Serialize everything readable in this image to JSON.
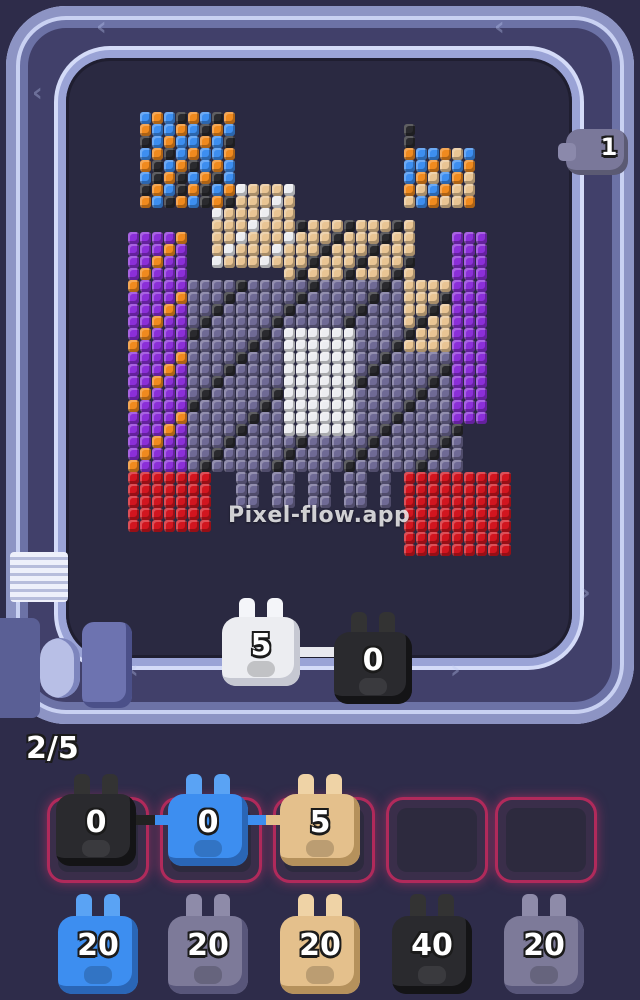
{
  "watermark": {
    "text": "Pixel-flow.app"
  },
  "track_counter": {
    "value": "1"
  },
  "progress": {
    "text": "2/5"
  },
  "conveyor_pigs": [
    {
      "color": "white",
      "count": "5"
    },
    {
      "color": "black",
      "count": "0"
    }
  ],
  "slots": [
    {
      "color": "black",
      "count": "0",
      "filled": true
    },
    {
      "color": "blue",
      "count": "0",
      "filled": true
    },
    {
      "color": "tan",
      "count": "5",
      "filled": true
    },
    {
      "filled": false
    },
    {
      "filled": false
    }
  ],
  "queue_pigs": [
    {
      "color": "blue",
      "count": "20"
    },
    {
      "color": "gray",
      "count": "20"
    },
    {
      "color": "tan",
      "count": "20"
    },
    {
      "color": "black",
      "count": "40"
    },
    {
      "color": "gray",
      "count": "20"
    }
  ],
  "colors": {
    "white": "#ecedf1",
    "black": "#2a2a2e",
    "blue": "#3d8ef0",
    "tan": "#e4c08c",
    "gray": "#7d7a99",
    "track": "#8d94c4",
    "slot_glow": "#e2326e",
    "red": "#d2151f",
    "purple": "#8b2fd8",
    "orange": "#f08a1e",
    "skin": "#e9c594",
    "lavender": "#6f6a95"
  }
}
